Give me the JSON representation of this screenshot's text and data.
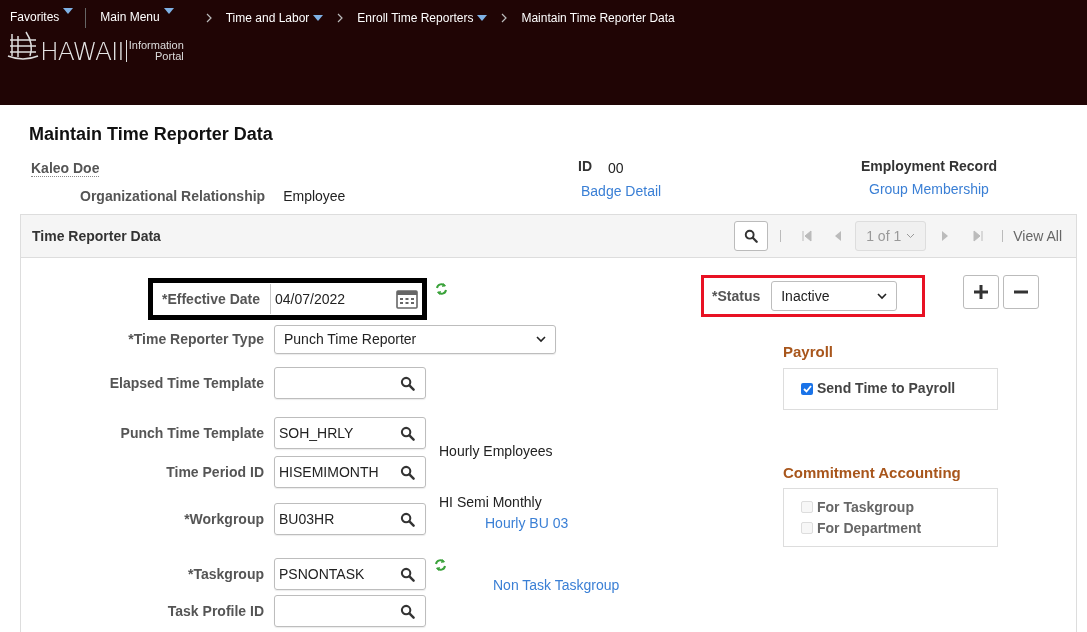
{
  "header": {
    "nav": [
      {
        "label": "Favorites",
        "dropdown": true
      },
      {
        "label": "Main Menu",
        "dropdown": true
      }
    ],
    "breadcrumbs": [
      {
        "label": "Time and Labor",
        "dropdown": true
      },
      {
        "label": "Enroll Time Reporters",
        "dropdown": true
      },
      {
        "label": "Maintain Time Reporter Data",
        "dropdown": false
      }
    ],
    "logo": {
      "name": "HAWAII",
      "line1": "Information",
      "line2": "Portal"
    }
  },
  "page_title": "Maintain Time Reporter Data",
  "employee": {
    "name": "Kaleo Doe",
    "org_label": "Organizational Relationship",
    "org_value": "Employee",
    "id_label": "ID",
    "id_value": "00",
    "badge_link": "Badge Detail",
    "record_label": "Employment Record",
    "group_link": "Group Membership"
  },
  "panel": {
    "title": "Time Reporter Data",
    "pager": "1 of 1",
    "view_all": "View All"
  },
  "fields": [
    {
      "kind": "date",
      "label": "*Effective Date",
      "value": "04/07/2022",
      "color": "#000000",
      "refresh": true
    },
    {
      "kind": "select",
      "label": "*Time Reporter Type",
      "value": "Punch Time Reporter",
      "refresh": false
    },
    {
      "kind": "prompt",
      "label": "Elapsed Time Template",
      "refresh": false
    },
    {
      "kind": "prompt",
      "label": "Punch Time Template",
      "value": "SOH_HRLY",
      "refresh": false,
      "description": "Hourly Employees"
    },
    {
      "kind": "prompt",
      "label": "Time Period ID",
      "value": "HISEMIMONTH",
      "refresh": false,
      "description": "HI Semi Monthly"
    },
    {
      "kind": "prompt",
      "label": "*Workgroup",
      "value": "BU03HR",
      "refresh": false,
      "link": "Hourly BU 03"
    },
    {
      "kind": "prompt",
      "label": "*Taskgroup",
      "value": "PSNONTASK",
      "refresh": true,
      "link": "Non Task Taskgroup"
    },
    {
      "kind": "prompt",
      "label": "Task Profile ID",
      "refresh": false
    }
  ],
  "status": {
    "label": "*Status",
    "value": "Inactive",
    "color": "#e81123"
  },
  "groups": [
    {
      "title": "Payroll",
      "options": [
        {
          "label": "Send Time to Payroll",
          "checked": true,
          "disabled": false
        }
      ]
    },
    {
      "title": "Commitment Accounting",
      "options": [
        {
          "label": "For Taskgroup",
          "checked": false,
          "disabled": true
        },
        {
          "label": "For Department",
          "checked": false,
          "disabled": true
        }
      ]
    }
  ]
}
